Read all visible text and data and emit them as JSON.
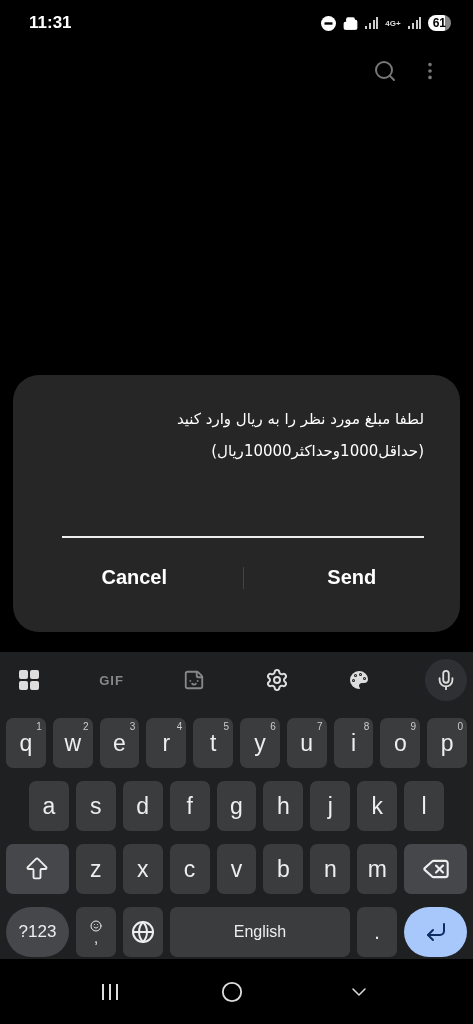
{
  "status_bar": {
    "time": "11:31",
    "network": "4G+",
    "battery": "61"
  },
  "dialog": {
    "message": [
      "لطفا مبلغ مورد نظر را به ریال وارد کنید",
      "(حداقل1000وحداکثر10000ریال)"
    ],
    "buttons": [
      "Cancel",
      "Send"
    ]
  },
  "keyboard": {
    "toolbar": [
      {
        "kind": "apps"
      },
      {
        "kind": "gif",
        "label": "GIF"
      },
      {
        "kind": "sticker"
      },
      {
        "kind": "settings"
      },
      {
        "kind": "theme"
      },
      {
        "kind": "mic"
      }
    ],
    "rows": [
      {
        "keys": [
          {
            "kind": "letter",
            "label": "q",
            "hint": "1"
          },
          {
            "kind": "letter",
            "label": "w",
            "hint": "2"
          },
          {
            "kind": "letter",
            "label": "e",
            "hint": "3"
          },
          {
            "kind": "letter",
            "label": "r",
            "hint": "4"
          },
          {
            "kind": "letter",
            "label": "t",
            "hint": "5"
          },
          {
            "kind": "letter",
            "label": "y",
            "hint": "6"
          },
          {
            "kind": "letter",
            "label": "u",
            "hint": "7"
          },
          {
            "kind": "letter",
            "label": "i",
            "hint": "8"
          },
          {
            "kind": "letter",
            "label": "o",
            "hint": "9"
          },
          {
            "kind": "letter",
            "label": "p",
            "hint": "0"
          }
        ]
      },
      {
        "keys": [
          {
            "kind": "letter",
            "label": "a"
          },
          {
            "kind": "letter",
            "label": "s"
          },
          {
            "kind": "letter",
            "label": "d"
          },
          {
            "kind": "letter",
            "label": "f"
          },
          {
            "kind": "letter",
            "label": "g"
          },
          {
            "kind": "letter",
            "label": "h"
          },
          {
            "kind": "letter",
            "label": "j"
          },
          {
            "kind": "letter",
            "label": "k"
          },
          {
            "kind": "letter",
            "label": "l"
          }
        ]
      },
      {
        "keys": [
          {
            "kind": "shift"
          },
          {
            "kind": "letter",
            "label": "z"
          },
          {
            "kind": "letter",
            "label": "x"
          },
          {
            "kind": "letter",
            "label": "c"
          },
          {
            "kind": "letter",
            "label": "v"
          },
          {
            "kind": "letter",
            "label": "b"
          },
          {
            "kind": "letter",
            "label": "n"
          },
          {
            "kind": "letter",
            "label": "m"
          },
          {
            "kind": "backspace"
          }
        ]
      },
      {
        "keys": [
          {
            "kind": "symbols",
            "label": "?123"
          },
          {
            "kind": "emoji",
            "label": ","
          },
          {
            "kind": "globe"
          },
          {
            "kind": "space",
            "label": "English"
          },
          {
            "kind": "period",
            "label": "."
          },
          {
            "kind": "enter"
          }
        ]
      }
    ]
  }
}
